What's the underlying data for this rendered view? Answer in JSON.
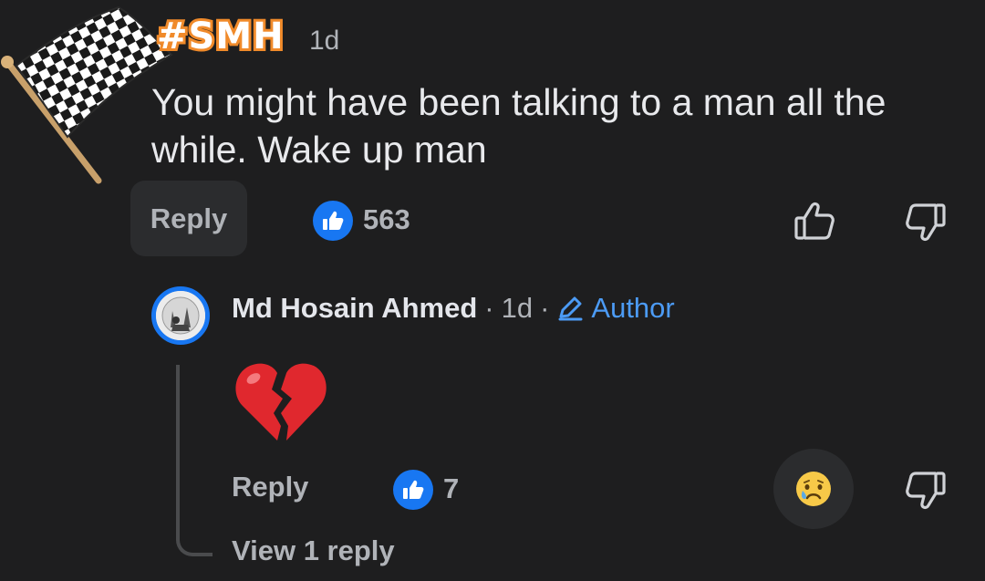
{
  "comment": {
    "sticker_tag": "#SMH",
    "sticker_icon": "checkered-flag-icon",
    "time": "1d",
    "text": "You might have been talking to a man all the while. Wake up man",
    "reply_label": "Reply",
    "like_count": "563"
  },
  "reply": {
    "author": "Md Hosain Ahmed",
    "separator": "·",
    "time": "1d",
    "author_badge": "Author",
    "content_icon": "broken-heart-emoji",
    "reply_label": "Reply",
    "like_count": "7",
    "reaction_icon": "sad-face-emoji",
    "view_replies_label": "View 1 reply"
  },
  "colors": {
    "background": "#1e1e1f",
    "accent": "#1877f2",
    "author_badge": "#4c9bf5",
    "secondary_text": "#b0b3b8",
    "sticker_outline": "#f08a2a"
  }
}
